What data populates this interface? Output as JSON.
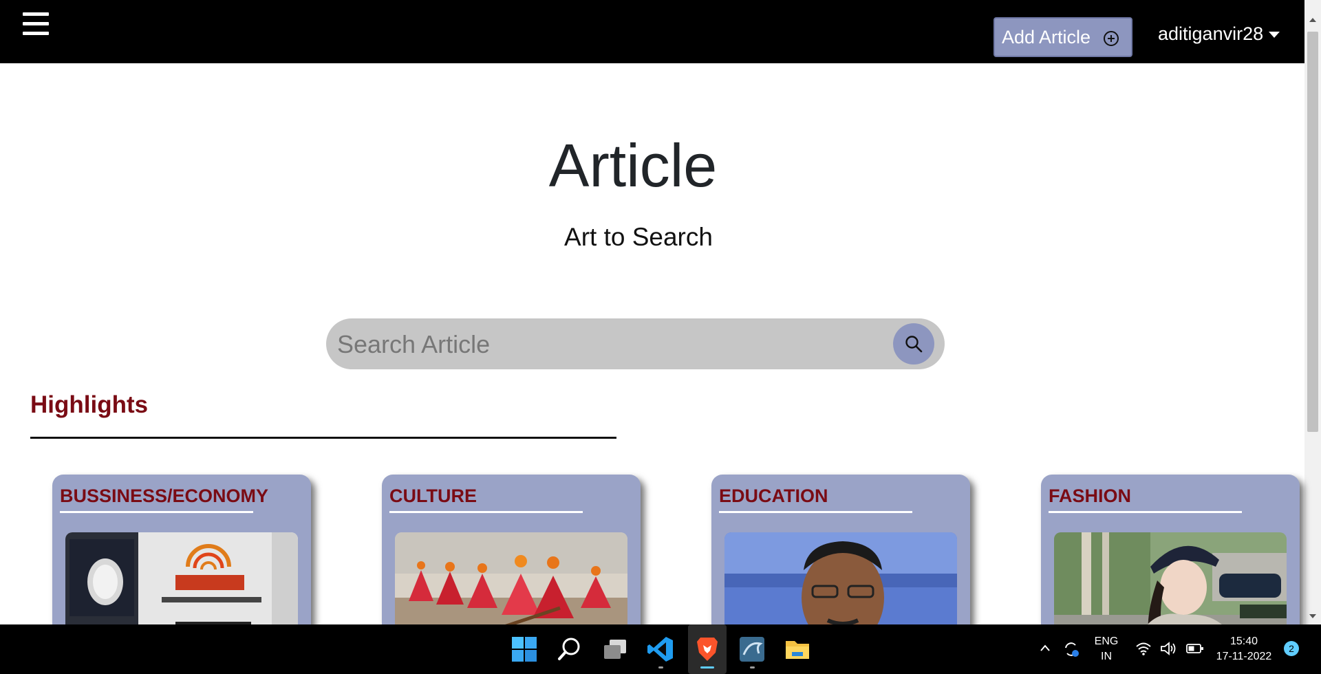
{
  "navbar": {
    "menu_icon": "hamburger-menu-icon",
    "add_article_label": "Add Article",
    "add_icon": "plus-circle-icon",
    "username": "aditiganvir28"
  },
  "hero": {
    "title": "Article",
    "subtitle": "Art to Search"
  },
  "search": {
    "placeholder": "Search Article",
    "icon": "search-icon"
  },
  "highlights": {
    "heading": "Highlights",
    "cards": [
      {
        "title": "BUSSINESS/ECONOMY"
      },
      {
        "title": "CULTURE"
      },
      {
        "title": "EDUCATION"
      },
      {
        "title": "FASHION"
      }
    ]
  },
  "taskbar": {
    "apps": [
      "windows-start-icon",
      "search-icon",
      "task-view-icon",
      "vscode-icon",
      "brave-browser-icon",
      "mysql-workbench-icon",
      "file-explorer-icon"
    ],
    "language": "ENG",
    "region": "IN",
    "time": "15:40",
    "date": "17-11-2022",
    "notification_count": "2"
  },
  "colors": {
    "navbar": "#000000",
    "accent": "#8d96bf",
    "card_bg": "#9aa3c7",
    "heading_red": "#7a0b14"
  }
}
